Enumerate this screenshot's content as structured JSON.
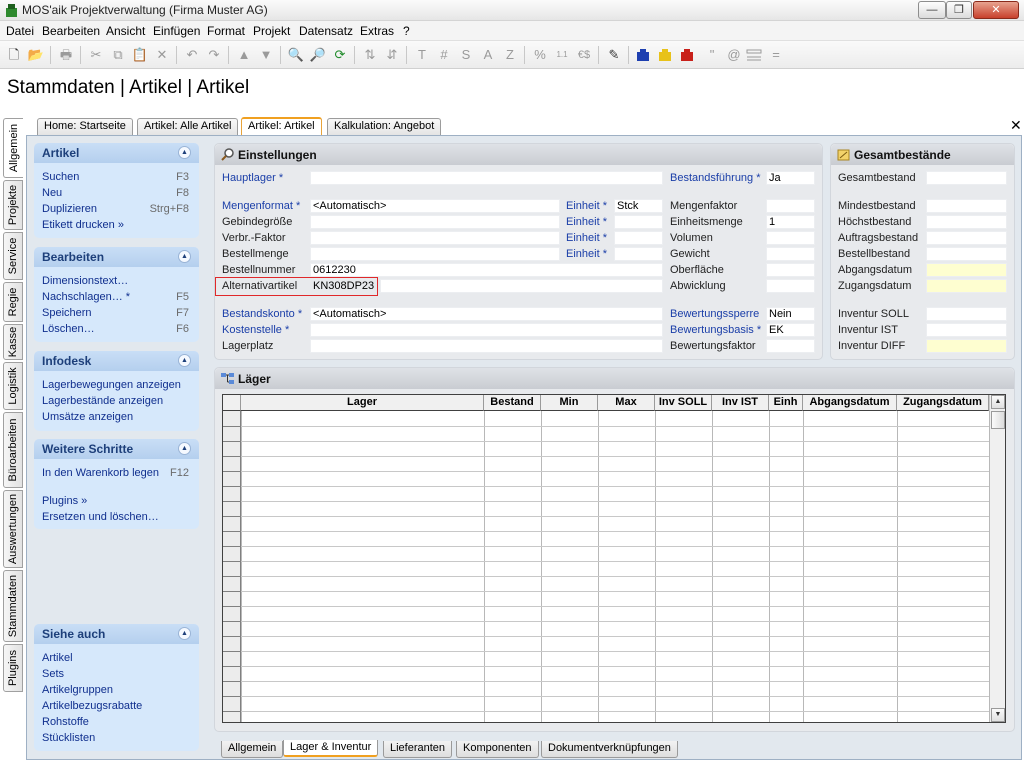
{
  "window": {
    "title": "MOS'aik Projektverwaltung (Firma Muster AG)",
    "minimize": "—",
    "maximize": "❐",
    "close": "✕"
  },
  "menu": [
    "Datei",
    "Bearbeiten",
    "Ansicht",
    "Einfügen",
    "Format",
    "Projekt",
    "Datensatz",
    "Extras",
    "?"
  ],
  "toolbar": {
    "new": "🗋",
    "open": "📂",
    "print": "🖶",
    "cut": "✂",
    "copy": "⧉",
    "paste": "📋",
    "delete": "✕",
    "undo": "↶",
    "redo": "↷",
    "up": "▲",
    "down": "▼",
    "search": "🔍",
    "search2": "🔎",
    "refresh": "⟳",
    "sort_asc": "⇅",
    "sort_desc": "⇵",
    "t": "T",
    "hash": "#",
    "s": "S",
    "a": "A",
    "z": "Z",
    "percent": "%",
    "num": "1.1",
    "euro": "€$",
    "edit": "✎",
    "quote": "\"",
    "at": "@",
    "equals": "="
  },
  "page": {
    "title": "Stammdaten | Artikel | Artikel"
  },
  "doc_tabs": [
    {
      "label": "Home: Startseite"
    },
    {
      "label": "Artikel: Alle Artikel"
    },
    {
      "label": "Artikel: Artikel"
    },
    {
      "label": "Kalkulation: Angebot"
    }
  ],
  "doc_close": "✕",
  "left_tabs": [
    "Allgemein",
    "Projekte",
    "Service",
    "Regie",
    "Kasse",
    "Logistik",
    "Büroarbeiten",
    "Auswertungen",
    "Stammdaten",
    "Plugins"
  ],
  "sidebar": {
    "artikel": {
      "title": "Artikel",
      "items": [
        {
          "label": "Suchen",
          "key": "F3"
        },
        {
          "label": "Neu",
          "key": "F8"
        },
        {
          "label": "Duplizieren",
          "key": "Strg+F8"
        },
        {
          "label": "Etikett drucken »",
          "key": ""
        }
      ]
    },
    "bearbeiten": {
      "title": "Bearbeiten",
      "items": [
        {
          "label": "Dimensionstext…",
          "key": ""
        },
        {
          "label": "Nachschlagen… *",
          "key": "F5"
        },
        {
          "label": "Speichern",
          "key": "F7"
        },
        {
          "label": "Löschen…",
          "key": "F6"
        }
      ]
    },
    "infodesk": {
      "title": "Infodesk",
      "items": [
        {
          "label": "Lagerbewegungen anzeigen"
        },
        {
          "label": "Lagerbestände anzeigen"
        },
        {
          "label": "Umsätze anzeigen"
        }
      ]
    },
    "weitere": {
      "title": "Weitere Schritte",
      "items": [
        {
          "label": "In den Warenkorb legen",
          "key": "F12"
        },
        {
          "label": "Plugins »"
        },
        {
          "label": "Ersetzen und löschen…"
        }
      ]
    },
    "siehe": {
      "title": "Siehe auch",
      "items": [
        {
          "label": "Artikel"
        },
        {
          "label": "Sets"
        },
        {
          "label": "Artikelgruppen"
        },
        {
          "label": "Artikelbezugsrabatte"
        },
        {
          "label": "Rohstoffe"
        },
        {
          "label": "Stücklisten"
        }
      ]
    }
  },
  "einstellungen": {
    "title": "Einstellungen",
    "hauptlager": {
      "label": "Hauptlager *",
      "value": ""
    },
    "bestandsfuehrung": {
      "label": "Bestandsführung *",
      "value": "Ja"
    },
    "mengenformat": {
      "label": "Mengenformat *",
      "value": "<Automatisch>"
    },
    "gebindegroesse": {
      "label": "Gebindegröße",
      "value": ""
    },
    "verbr_faktor": {
      "label": "Verbr.-Faktor",
      "value": ""
    },
    "bestellmenge": {
      "label": "Bestellmenge",
      "value": ""
    },
    "bestellnummer": {
      "label": "Bestellnummer",
      "value": "0612230"
    },
    "alternativartikel": {
      "label": "Alternativartikel",
      "value": "KN308DP23"
    },
    "einheit1": {
      "label": "Einheit *",
      "value": "Stck"
    },
    "einheit2": {
      "label": "Einheit *",
      "value": ""
    },
    "einheit3": {
      "label": "Einheit *",
      "value": ""
    },
    "einheit4": {
      "label": "Einheit *",
      "value": ""
    },
    "mengenfaktor": {
      "label": "Mengenfaktor",
      "value": ""
    },
    "einheitsmenge": {
      "label": "Einheitsmenge",
      "value": "1"
    },
    "volumen": {
      "label": "Volumen",
      "value": ""
    },
    "gewicht": {
      "label": "Gewicht",
      "value": ""
    },
    "oberflaeche": {
      "label": "Oberfläche",
      "value": ""
    },
    "abwicklung": {
      "label": "Abwicklung",
      "value": ""
    },
    "bestandskonto": {
      "label": "Bestandskonto *",
      "value": "<Automatisch>"
    },
    "kostenstelle": {
      "label": "Kostenstelle *",
      "value": ""
    },
    "lagerplatz": {
      "label": "Lagerplatz",
      "value": ""
    },
    "bewertungssperre": {
      "label": "Bewertungssperre",
      "value": "Nein"
    },
    "bewertungsbasis": {
      "label": "Bewertungsbasis *",
      "value": "EK"
    },
    "bewertungsfaktor": {
      "label": "Bewertungsfaktor",
      "value": ""
    }
  },
  "gesamt": {
    "title": "Gesamtbestände",
    "rows": [
      {
        "label": "Gesamtbestand",
        "value": ""
      },
      {
        "label": "Mindestbestand",
        "value": ""
      },
      {
        "label": "Höchstbestand",
        "value": ""
      },
      {
        "label": "Auftragsbestand",
        "value": ""
      },
      {
        "label": "Bestellbestand",
        "value": ""
      },
      {
        "label": "Abgangsdatum",
        "value": ""
      },
      {
        "label": "Zugangsdatum",
        "value": ""
      },
      {
        "label": "Inventur SOLL",
        "value": ""
      },
      {
        "label": "Inventur IST",
        "value": ""
      },
      {
        "label": "Inventur DIFF",
        "value": ""
      }
    ]
  },
  "laeger": {
    "title": "Läger",
    "columns": [
      "Lager",
      "Bestand",
      "Min",
      "Max",
      "Inv SOLL",
      "Inv IST",
      "Einh",
      "Abgangsdatum",
      "Zugangsdatum"
    ]
  },
  "scroll": {
    "up": "▲",
    "down": "▼"
  },
  "bottom_tabs": [
    "Allgemein",
    "Lager & Inventur",
    "Lieferanten",
    "Komponenten",
    "Dokumentverknüpfungen"
  ]
}
